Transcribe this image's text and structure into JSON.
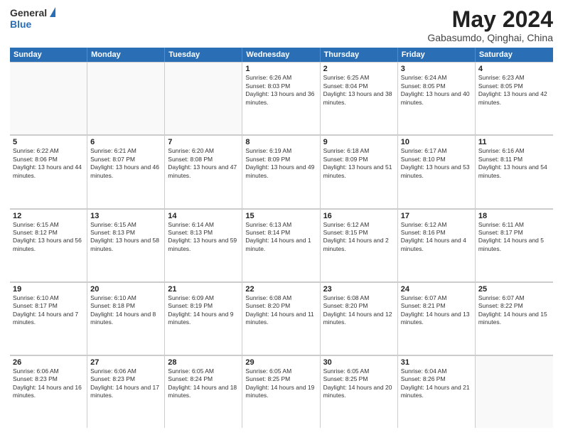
{
  "header": {
    "logo_general": "General",
    "logo_blue": "Blue",
    "title": "May 2024",
    "location": "Gabasumdo, Qinghai, China"
  },
  "weekdays": [
    "Sunday",
    "Monday",
    "Tuesday",
    "Wednesday",
    "Thursday",
    "Friday",
    "Saturday"
  ],
  "rows": [
    [
      {
        "day": "",
        "sunrise": "",
        "sunset": "",
        "daylight": "",
        "empty": true
      },
      {
        "day": "",
        "sunrise": "",
        "sunset": "",
        "daylight": "",
        "empty": true
      },
      {
        "day": "",
        "sunrise": "",
        "sunset": "",
        "daylight": "",
        "empty": true
      },
      {
        "day": "1",
        "sunrise": "Sunrise: 6:26 AM",
        "sunset": "Sunset: 8:03 PM",
        "daylight": "Daylight: 13 hours and 36 minutes."
      },
      {
        "day": "2",
        "sunrise": "Sunrise: 6:25 AM",
        "sunset": "Sunset: 8:04 PM",
        "daylight": "Daylight: 13 hours and 38 minutes."
      },
      {
        "day": "3",
        "sunrise": "Sunrise: 6:24 AM",
        "sunset": "Sunset: 8:05 PM",
        "daylight": "Daylight: 13 hours and 40 minutes."
      },
      {
        "day": "4",
        "sunrise": "Sunrise: 6:23 AM",
        "sunset": "Sunset: 8:05 PM",
        "daylight": "Daylight: 13 hours and 42 minutes."
      }
    ],
    [
      {
        "day": "5",
        "sunrise": "Sunrise: 6:22 AM",
        "sunset": "Sunset: 8:06 PM",
        "daylight": "Daylight: 13 hours and 44 minutes."
      },
      {
        "day": "6",
        "sunrise": "Sunrise: 6:21 AM",
        "sunset": "Sunset: 8:07 PM",
        "daylight": "Daylight: 13 hours and 46 minutes."
      },
      {
        "day": "7",
        "sunrise": "Sunrise: 6:20 AM",
        "sunset": "Sunset: 8:08 PM",
        "daylight": "Daylight: 13 hours and 47 minutes."
      },
      {
        "day": "8",
        "sunrise": "Sunrise: 6:19 AM",
        "sunset": "Sunset: 8:09 PM",
        "daylight": "Daylight: 13 hours and 49 minutes."
      },
      {
        "day": "9",
        "sunrise": "Sunrise: 6:18 AM",
        "sunset": "Sunset: 8:09 PM",
        "daylight": "Daylight: 13 hours and 51 minutes."
      },
      {
        "day": "10",
        "sunrise": "Sunrise: 6:17 AM",
        "sunset": "Sunset: 8:10 PM",
        "daylight": "Daylight: 13 hours and 53 minutes."
      },
      {
        "day": "11",
        "sunrise": "Sunrise: 6:16 AM",
        "sunset": "Sunset: 8:11 PM",
        "daylight": "Daylight: 13 hours and 54 minutes."
      }
    ],
    [
      {
        "day": "12",
        "sunrise": "Sunrise: 6:15 AM",
        "sunset": "Sunset: 8:12 PM",
        "daylight": "Daylight: 13 hours and 56 minutes."
      },
      {
        "day": "13",
        "sunrise": "Sunrise: 6:15 AM",
        "sunset": "Sunset: 8:13 PM",
        "daylight": "Daylight: 13 hours and 58 minutes."
      },
      {
        "day": "14",
        "sunrise": "Sunrise: 6:14 AM",
        "sunset": "Sunset: 8:13 PM",
        "daylight": "Daylight: 13 hours and 59 minutes."
      },
      {
        "day": "15",
        "sunrise": "Sunrise: 6:13 AM",
        "sunset": "Sunset: 8:14 PM",
        "daylight": "Daylight: 14 hours and 1 minute."
      },
      {
        "day": "16",
        "sunrise": "Sunrise: 6:12 AM",
        "sunset": "Sunset: 8:15 PM",
        "daylight": "Daylight: 14 hours and 2 minutes."
      },
      {
        "day": "17",
        "sunrise": "Sunrise: 6:12 AM",
        "sunset": "Sunset: 8:16 PM",
        "daylight": "Daylight: 14 hours and 4 minutes."
      },
      {
        "day": "18",
        "sunrise": "Sunrise: 6:11 AM",
        "sunset": "Sunset: 8:17 PM",
        "daylight": "Daylight: 14 hours and 5 minutes."
      }
    ],
    [
      {
        "day": "19",
        "sunrise": "Sunrise: 6:10 AM",
        "sunset": "Sunset: 8:17 PM",
        "daylight": "Daylight: 14 hours and 7 minutes."
      },
      {
        "day": "20",
        "sunrise": "Sunrise: 6:10 AM",
        "sunset": "Sunset: 8:18 PM",
        "daylight": "Daylight: 14 hours and 8 minutes."
      },
      {
        "day": "21",
        "sunrise": "Sunrise: 6:09 AM",
        "sunset": "Sunset: 8:19 PM",
        "daylight": "Daylight: 14 hours and 9 minutes."
      },
      {
        "day": "22",
        "sunrise": "Sunrise: 6:08 AM",
        "sunset": "Sunset: 8:20 PM",
        "daylight": "Daylight: 14 hours and 11 minutes."
      },
      {
        "day": "23",
        "sunrise": "Sunrise: 6:08 AM",
        "sunset": "Sunset: 8:20 PM",
        "daylight": "Daylight: 14 hours and 12 minutes."
      },
      {
        "day": "24",
        "sunrise": "Sunrise: 6:07 AM",
        "sunset": "Sunset: 8:21 PM",
        "daylight": "Daylight: 14 hours and 13 minutes."
      },
      {
        "day": "25",
        "sunrise": "Sunrise: 6:07 AM",
        "sunset": "Sunset: 8:22 PM",
        "daylight": "Daylight: 14 hours and 15 minutes."
      }
    ],
    [
      {
        "day": "26",
        "sunrise": "Sunrise: 6:06 AM",
        "sunset": "Sunset: 8:23 PM",
        "daylight": "Daylight: 14 hours and 16 minutes."
      },
      {
        "day": "27",
        "sunrise": "Sunrise: 6:06 AM",
        "sunset": "Sunset: 8:23 PM",
        "daylight": "Daylight: 14 hours and 17 minutes."
      },
      {
        "day": "28",
        "sunrise": "Sunrise: 6:05 AM",
        "sunset": "Sunset: 8:24 PM",
        "daylight": "Daylight: 14 hours and 18 minutes."
      },
      {
        "day": "29",
        "sunrise": "Sunrise: 6:05 AM",
        "sunset": "Sunset: 8:25 PM",
        "daylight": "Daylight: 14 hours and 19 minutes."
      },
      {
        "day": "30",
        "sunrise": "Sunrise: 6:05 AM",
        "sunset": "Sunset: 8:25 PM",
        "daylight": "Daylight: 14 hours and 20 minutes."
      },
      {
        "day": "31",
        "sunrise": "Sunrise: 6:04 AM",
        "sunset": "Sunset: 8:26 PM",
        "daylight": "Daylight: 14 hours and 21 minutes."
      },
      {
        "day": "",
        "sunrise": "",
        "sunset": "",
        "daylight": "",
        "empty": true
      }
    ]
  ]
}
